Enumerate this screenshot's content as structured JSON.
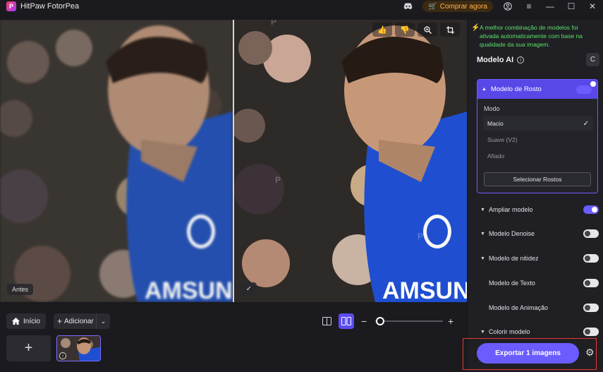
{
  "app": {
    "title": "HitPaw FotorPea",
    "buy_label": "Comprar agora"
  },
  "viewer": {
    "before_label": "Antes"
  },
  "bottom": {
    "home_label": "Início",
    "add_label": "Adicionar"
  },
  "panel": {
    "notice": "A melhor combinação de modelos foi ativada automaticamente com base na qualidade da sua imagem.",
    "section_title": "Modelo AI",
    "face_model": {
      "label": "Modelo de Rosto",
      "enabled": true
    },
    "mode_label": "Modo",
    "modes": [
      {
        "label": "Macio",
        "selected": true
      },
      {
        "label": "Suave (V2)",
        "selected": false
      },
      {
        "label": "Afiado",
        "selected": false
      }
    ],
    "select_faces_label": "Selecionar Rostos",
    "models": [
      {
        "label": "Ampliar modelo",
        "enabled": true,
        "expandable": true
      },
      {
        "label": "Modelo Denoise",
        "enabled": false,
        "expandable": true
      },
      {
        "label": "Modelo de nitidez",
        "enabled": false,
        "expandable": true
      },
      {
        "label": "Modelo de Texto",
        "enabled": false,
        "expandable": false
      },
      {
        "label": "Modelo de Animação",
        "enabled": false,
        "expandable": false
      },
      {
        "label": "Colorir modelo",
        "enabled": false,
        "expandable": true
      }
    ],
    "export_label": "Exportar 1 imagens"
  },
  "colors": {
    "accent": "#6a5cff",
    "notice": "#5be36a",
    "buy": "#ffb547",
    "highlight_border": "#e53935"
  }
}
